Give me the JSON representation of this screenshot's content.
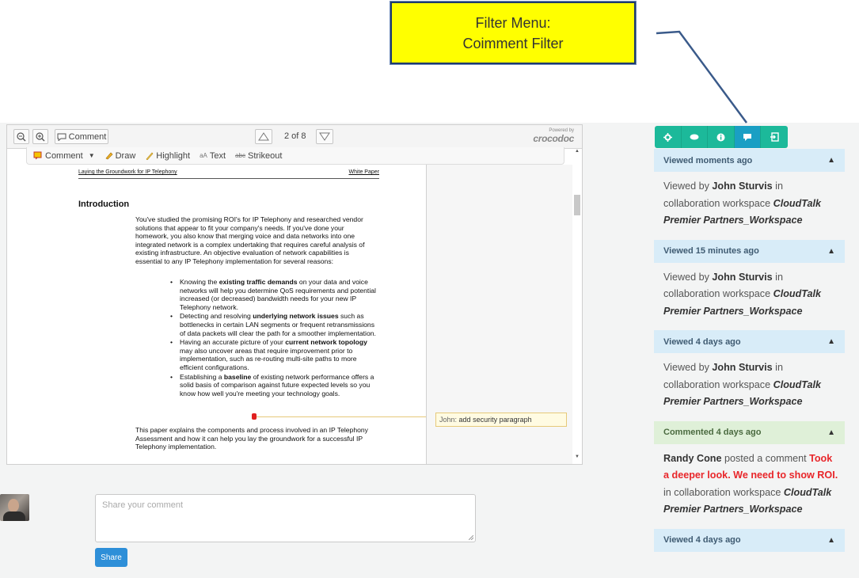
{
  "callout": {
    "line1": "Filter Menu:",
    "line2": "Coimment Filter"
  },
  "viewer": {
    "toolbar": {
      "zoom_out": "zoom-out-icon",
      "zoom_in": "zoom-in-icon",
      "comment_label": "Comment",
      "pager": "2 of 8",
      "powered_by": "Powered by",
      "brand": "crocodoc"
    },
    "annot_tools": {
      "comment": "Comment",
      "draw": "Draw",
      "highlight": "Highlight",
      "text": "Text",
      "strikeout": "Strikeout"
    },
    "document": {
      "header_left": "Laying the Groundwork for IP Telephony",
      "header_right": "White Paper",
      "heading": "Introduction",
      "para1": "You've studied the promising ROI's for IP Telephony and researched vendor solutions that appear to fit your company's needs. If you've done your homework, you also know that merging voice and data networks into one integrated network is a complex undertaking that requires careful analysis of existing infrastructure. An objective evaluation of network capabilities is essential to any IP Telephony implementation for several reasons:",
      "bullets": [
        {
          "pre": "Knowing the ",
          "bold": "existing traffic demands",
          "post": " on your data and voice networks will help you determine QoS requirements and potential increased (or decreased) bandwidth needs for your new IP Telephony network."
        },
        {
          "pre": "Detecting and resolving ",
          "bold": "underlying network issues",
          "post": " such as bottlenecks in certain LAN segments or frequent retransmissions of data packets will clear the path for a smoother implementation."
        },
        {
          "pre": "Having an accurate picture of your ",
          "bold": "current network topology",
          "post": " may also uncover areas that require improvement prior to implementation, such as re-routing multi-site paths to more efficient configurations."
        },
        {
          "pre": "Establishing a ",
          "bold": "baseline",
          "post": " of existing network performance offers a solid basis of comparison against future expected levels so you know how well you're meeting your technology goals."
        }
      ],
      "para2": "This paper explains the components and process involved in an IP Telephony Assessment and how it can help you lay the groundwork for a successful IP Telephony implementation."
    },
    "annotation": {
      "author": "John:",
      "text": "add security paragraph"
    }
  },
  "comment_form": {
    "placeholder": "Share your comment",
    "share_label": "Share"
  },
  "filter_menu": [
    "gear-icon",
    "eye-icon",
    "info-icon",
    "comment-icon",
    "exit-icon"
  ],
  "activity": [
    {
      "header": "Viewed moments ago",
      "type": "view",
      "pre": "Viewed by ",
      "user": "John Sturvis",
      "mid": " in collaboration workspace ",
      "workspace": "CloudTalk Premier Partners_Workspace"
    },
    {
      "header": "Viewed 15 minutes ago",
      "type": "view",
      "pre": "Viewed by ",
      "user": "John Sturvis",
      "mid": " in collaboration workspace ",
      "workspace": "CloudTalk Premier Partners_Workspace"
    },
    {
      "header": "Viewed 4 days ago",
      "type": "view",
      "pre": "Viewed by ",
      "user": "John Sturvis",
      "mid": " in collaboration workspace ",
      "workspace": "CloudTalk Premier Partners_Workspace"
    },
    {
      "header": "Commented 4 days ago",
      "type": "comment",
      "user": "Randy Cone",
      "pre": " posted a comment ",
      "comment": "Took a deeper look. We need to show ROI.",
      "mid": " in collaboration workspace ",
      "workspace": "CloudTalk Premier Partners_Workspace"
    },
    {
      "header": "Viewed 4 days ago",
      "type": "view"
    }
  ],
  "colors": {
    "callout_bg": "#ffff00",
    "filter_green": "#1cb99a",
    "filter_active": "#1a9fc4",
    "view_header": "#d8ecf8",
    "comment_header": "#dff0d8",
    "share_blue": "#2e8fd8",
    "comment_red": "#e8262a"
  }
}
